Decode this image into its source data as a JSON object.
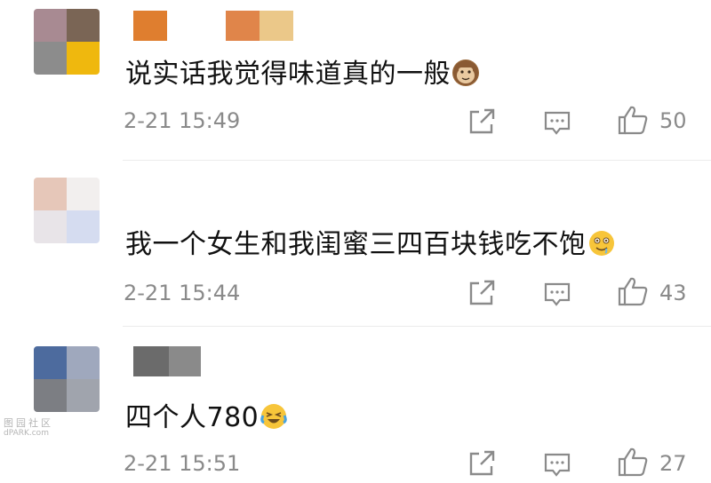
{
  "comments": [
    {
      "text": "说实话我觉得味道真的一般",
      "emoji": "monkey-face",
      "time": "2-21 15:49",
      "likes": "50",
      "avatar_colors": [
        "#a88a92",
        "#7a6555",
        "#8c8c8c",
        "#efb80e"
      ],
      "name_colors": [
        "#df7e2f",
        "#e0854a",
        "#ebc889"
      ]
    },
    {
      "text": "我一个女生和我闺蜜三四百块钱吃不饱",
      "emoji": "drooling-face",
      "time": "2-21 15:44",
      "likes": "43",
      "avatar_colors": [
        "#e6c7b9",
        "#f2efee",
        "#e8e4e8",
        "#d5dcf0"
      ],
      "name_colors": []
    },
    {
      "text": "四个人780",
      "emoji": "laughing-crying-face",
      "time": "2-21 15:51",
      "likes": "27",
      "avatar_colors": [
        "#4d6b9e",
        "#9fa8bd",
        "#7c7e83",
        "#a0a4ad"
      ],
      "name_colors": [
        "#6b6b6b",
        "#8a8a8a"
      ]
    }
  ],
  "actions": {
    "repost_icon": "share-icon",
    "comment_icon": "comment-icon",
    "like_icon": "thumbs-up-icon",
    "icon_color": "#8a8a8a"
  },
  "watermark": {
    "line1": "图园社区",
    "line2": "dPARK.com"
  }
}
